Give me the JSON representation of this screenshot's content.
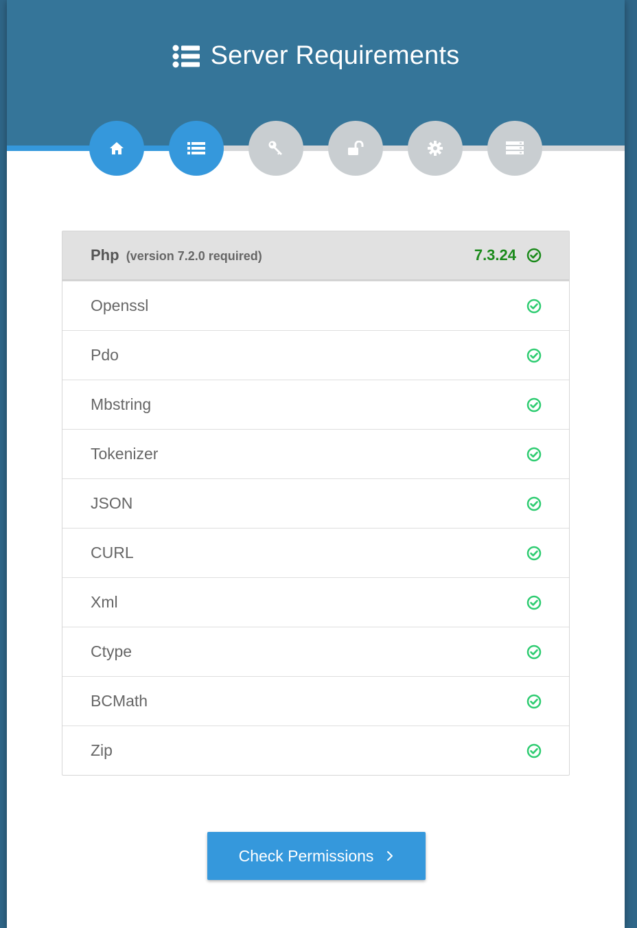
{
  "header": {
    "title": "Server Requirements",
    "title_icon": "list-icon"
  },
  "steps": [
    {
      "icon": "home-icon",
      "state": "complete"
    },
    {
      "icon": "list-icon",
      "state": "active"
    },
    {
      "icon": "key-icon",
      "state": "pending"
    },
    {
      "icon": "unlock-icon",
      "state": "pending"
    },
    {
      "icon": "gear-icon",
      "state": "pending"
    },
    {
      "icon": "server-icon",
      "state": "pending"
    }
  ],
  "requirements": {
    "php": {
      "label": "Php",
      "note": "(version 7.2.0 required)",
      "current_version": "7.3.24",
      "status": "ok"
    },
    "extensions": [
      {
        "label": "Openssl",
        "status": "ok"
      },
      {
        "label": "Pdo",
        "status": "ok"
      },
      {
        "label": "Mbstring",
        "status": "ok"
      },
      {
        "label": "Tokenizer",
        "status": "ok"
      },
      {
        "label": "JSON",
        "status": "ok"
      },
      {
        "label": "CURL",
        "status": "ok"
      },
      {
        "label": "Xml",
        "status": "ok"
      },
      {
        "label": "Ctype",
        "status": "ok"
      },
      {
        "label": "BCMath",
        "status": "ok"
      },
      {
        "label": "Zip",
        "status": "ok"
      }
    ]
  },
  "actions": {
    "next_label": "Check Permissions"
  },
  "colors": {
    "page_bg": "#2f6688",
    "header_bg": "#357599",
    "accent": "#3598dc",
    "step_inactive": "#c9ced1",
    "ok_green": "#1b8a1b",
    "check_green": "#2ecc71"
  }
}
